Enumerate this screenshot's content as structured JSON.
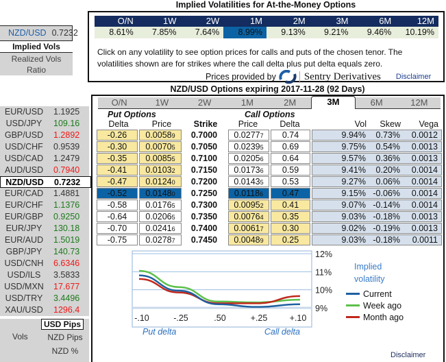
{
  "atm": {
    "title": "Implied Volatilities for At-the-Money Options",
    "tenors": [
      "O/N",
      "1W",
      "2W",
      "1M",
      "2M",
      "3M",
      "6M",
      "12M"
    ],
    "vols": [
      "8.61%",
      "7.85%",
      "7.64%",
      "8.99%",
      "9.13%",
      "9.21%",
      "9.46%",
      "10.19%"
    ],
    "selected": 3,
    "note": "Click on any volatility to see option prices for calls and puts of the chosen tenor. The volatilities shown are for strikes where the call delta plus put delta equals zero.",
    "provided_by": "Prices provided by",
    "provider": "Sentry Derivatives",
    "disclaimer": "Disclaimer"
  },
  "left": {
    "pair": "NZD/USD",
    "rate": "0.7232",
    "implied": "Implied Vols",
    "realized": "Realized Vols",
    "ratio": "Ratio",
    "list": [
      [
        "EUR/USD",
        "1.1925",
        "k"
      ],
      [
        "USD/JPY",
        "109.16",
        "g"
      ],
      [
        "GBP/USD",
        "1.2892",
        "r"
      ],
      [
        "USD/CHF",
        "0.9539",
        "k"
      ],
      [
        "USD/CAD",
        "1.2479",
        "k"
      ],
      [
        "AUD/USD",
        "0.7940",
        "r"
      ],
      [
        "NZD/USD",
        "0.7232",
        "sel"
      ],
      [
        "EUR/CAD",
        "1.4881",
        "k"
      ],
      [
        "EUR/CHF",
        "1.1376",
        "g"
      ],
      [
        "EUR/GBP",
        "0.9250",
        "g"
      ],
      [
        "EUR/JPY",
        "130.18",
        "g"
      ],
      [
        "EUR/AUD",
        "1.5019",
        "g"
      ],
      [
        "GBP/JPY",
        "140.73",
        "g"
      ],
      [
        "USD/CNH",
        "6.6346",
        "r"
      ],
      [
        "USD/ILS",
        "3.5833",
        "k"
      ],
      [
        "USD/MXN",
        "17.677",
        "r"
      ],
      [
        "USD/TRY",
        "3.4496",
        "g"
      ],
      [
        "XAU/USD",
        "1296.4",
        "r"
      ]
    ],
    "vols_label": "Vols",
    "units": [
      "USD Pips",
      "NZD Pips",
      "NZD %"
    ]
  },
  "options": {
    "title": "NZD/USD Options expiring 2017-11-28 (92 Days)",
    "tabs": [
      "O/N",
      "1W",
      "2W",
      "1M",
      "2M",
      "3M",
      "6M",
      "12M"
    ],
    "selected_tab": 5,
    "put_label": "Put Options",
    "call_label": "Call Options",
    "headers": [
      "Delta",
      "Price",
      "Strike",
      "Price",
      "Delta",
      "Vol",
      "Skew",
      "Vega"
    ],
    "rows": [
      [
        "-0.26",
        "0.0058",
        "9",
        "0.7000",
        "0.0277",
        "7",
        "0.74",
        "9.94%",
        "0.73%",
        "0.0012"
      ],
      [
        "-0.30",
        "0.0070",
        "5",
        "0.7050",
        "0.0239",
        "5",
        "0.69",
        "9.75%",
        "0.54%",
        "0.0013"
      ],
      [
        "-0.35",
        "0.0085",
        "5",
        "0.7100",
        "0.0205",
        "6",
        "0.64",
        "9.57%",
        "0.36%",
        "0.0013"
      ],
      [
        "-0.41",
        "0.0103",
        "2",
        "0.7150",
        "0.0173",
        "6",
        "0.59",
        "9.41%",
        "0.20%",
        "0.0014"
      ],
      [
        "-0.47",
        "0.0124",
        "0",
        "0.7200",
        "0.0143",
        "5",
        "0.53",
        "9.27%",
        "0.06%",
        "0.0014"
      ],
      [
        "-0.52",
        "0.0148",
        "0",
        "0.7250",
        "0.0118",
        "6",
        "0.47",
        "9.15%",
        "-0.06%",
        "0.0014"
      ],
      [
        "-0.58",
        "0.0176",
        "5",
        "0.7300",
        "0.0095",
        "2",
        "0.41",
        "9.07%",
        "-0.14%",
        "0.0014"
      ],
      [
        "-0.64",
        "0.0206",
        "5",
        "0.7350",
        "0.0076",
        "4",
        "0.35",
        "9.03%",
        "-0.18%",
        "0.0013"
      ],
      [
        "-0.70",
        "0.0241",
        "6",
        "0.7400",
        "0.0061",
        "7",
        "0.30",
        "9.02%",
        "-0.19%",
        "0.0013"
      ],
      [
        "-0.75",
        "0.0278",
        "7",
        "0.7450",
        "0.0048",
        "9",
        "0.25",
        "9.03%",
        "-0.18%",
        "0.0011"
      ]
    ],
    "atm_row": 5,
    "disclaimer": "Disclaimer"
  },
  "chart_data": {
    "type": "line",
    "title": "Implied volatility",
    "categories": [
      "-.10",
      "-.25",
      ".50",
      "+.25",
      "+.10"
    ],
    "yticks": [
      "12%",
      "11%",
      "10%",
      "9%"
    ],
    "ylim": [
      9,
      12
    ],
    "xlabel_left": "Put delta",
    "xlabel_right": "Call delta",
    "legend": "right",
    "grid": true,
    "series": [
      {
        "name": "Current",
        "color": "#1f5fa0",
        "values": [
          10.8,
          9.95,
          9.2,
          9.05,
          9.2
        ]
      },
      {
        "name": "Week ago",
        "color": "#5cc04a",
        "values": [
          11.05,
          10.15,
          9.35,
          9.3,
          9.45
        ]
      },
      {
        "name": "Month ago",
        "color": "#c0281c",
        "values": [
          10.6,
          9.85,
          9.25,
          9.25,
          9.65
        ]
      }
    ]
  }
}
